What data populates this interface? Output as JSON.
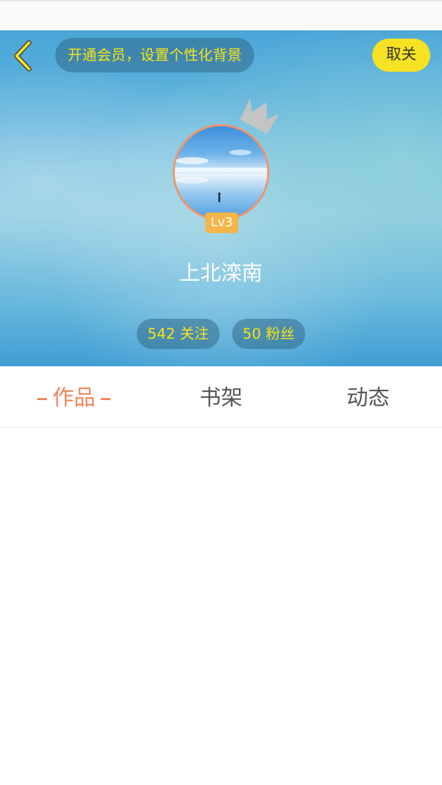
{
  "header": {
    "vip_banner": "开通会员，设置个性化背景",
    "cancel_label": "取关"
  },
  "profile": {
    "level": "Lv3",
    "username": "上北滦南",
    "following": "542 关注",
    "fans": "50 粉丝"
  },
  "tabs": [
    {
      "label": "作品",
      "active": true
    },
    {
      "label": "书架",
      "active": false
    },
    {
      "label": "动态",
      "active": false
    }
  ],
  "colors": {
    "accent_yellow": "#f8e21a",
    "active_tab": "#f0845a",
    "level_badge": "#f4b54a",
    "avatar_border": "#f0946a"
  }
}
